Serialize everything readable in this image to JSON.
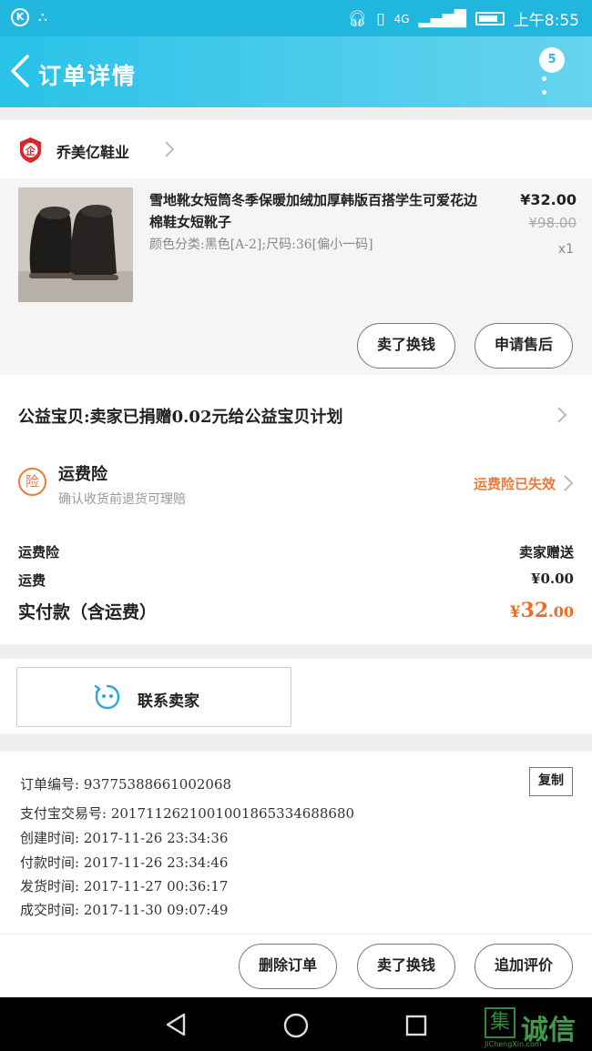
{
  "status_bar": {
    "time": "上午8:55",
    "network": "4G"
  },
  "header": {
    "title": "订单详情",
    "badge_count": "5"
  },
  "store": {
    "name": "乔美亿鞋业"
  },
  "product": {
    "title": "雪地靴女短筒冬季保暖加绒加厚韩版百搭学生可爱花边棉鞋女短靴子",
    "spec": "颜色分类:黑色[A-2];尺码:36[偏小一码]",
    "price": "¥32.00",
    "original_price": "¥98.00",
    "quantity": "x1",
    "buttons": {
      "exchange": "卖了换钱",
      "after_sales": "申请售后"
    }
  },
  "charity": {
    "text": "公益宝贝:卖家已捐赠0.02元给公益宝贝计划"
  },
  "insurance": {
    "icon_text": "险",
    "title": "运费险",
    "subtitle": "确认收货前退货可理赔",
    "status": "运费险已失效"
  },
  "fees": [
    {
      "label": "运费险",
      "value": "卖家赠送"
    },
    {
      "label": "运费",
      "value": "¥0.00"
    }
  ],
  "total": {
    "label": "实付款（含运费）",
    "currency": "¥",
    "integer": "32",
    "decimal": ".00"
  },
  "contact": {
    "label": "联系卖家"
  },
  "order_info": {
    "copy_label": "复制",
    "rows": [
      "订单编号: 93775388661002068",
      "支付宝交易号: 2017112621001001865334688680",
      "创建时间: 2017-11-26 23:34:36",
      "付款时间: 2017-11-26 23:34:46",
      "发货时间: 2017-11-27 00:36:17",
      "成交时间: 2017-11-30 09:07:49"
    ]
  },
  "actions": {
    "delete": "删除订单",
    "exchange": "卖了换钱",
    "review": "追加评价"
  },
  "watermark": {
    "mark": "集",
    "text": "诚信",
    "url": "JiChengXin.com"
  },
  "colors": {
    "header": "#29c2e8",
    "accent": "#ef6d21"
  }
}
